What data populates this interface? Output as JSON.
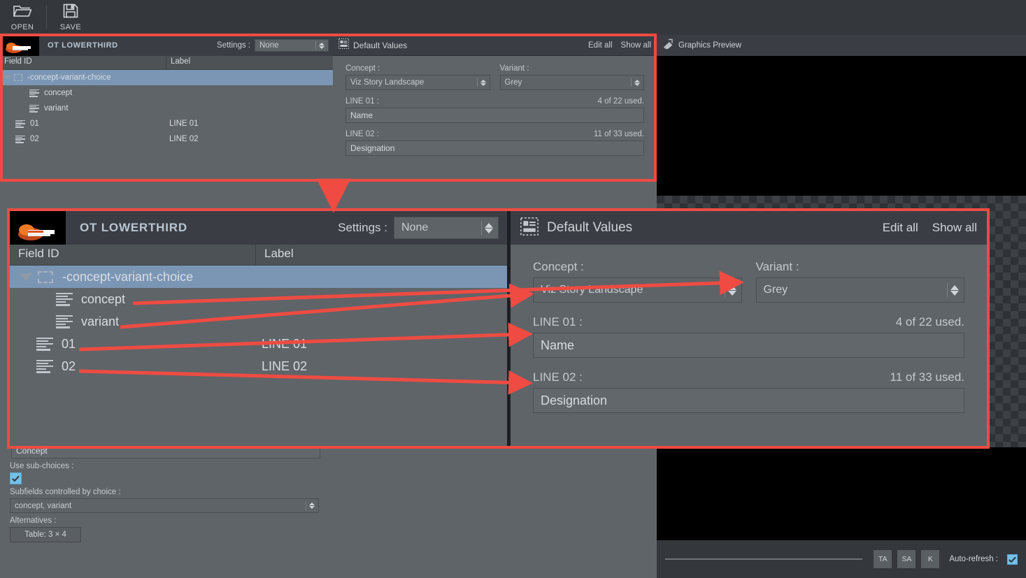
{
  "toolbar": {
    "buttons": [
      {
        "label": "OPEN",
        "icon": "folder-open-icon"
      },
      {
        "label": "SAVE",
        "icon": "floppy-disk-icon"
      }
    ]
  },
  "template_panel": {
    "title": "OT LOWERTHIRD",
    "settings_label": "Settings :",
    "settings_value": "None",
    "columns": {
      "field_id": "Field ID",
      "label": "Label"
    },
    "rows": [
      {
        "id": "-concept-variant-choice",
        "label": "",
        "icon": "dashed-box-icon",
        "indent": 0,
        "selected": true,
        "expanded": true
      },
      {
        "id": "concept",
        "label": "",
        "icon": "text-lines-icon",
        "indent": 2,
        "selected": false
      },
      {
        "id": "variant",
        "label": "",
        "icon": "text-lines-icon",
        "indent": 2,
        "selected": false
      },
      {
        "id": "01",
        "label": "LINE 01",
        "icon": "text-lines-icon",
        "indent": 1,
        "selected": false
      },
      {
        "id": "02",
        "label": "LINE 02",
        "icon": "text-lines-icon",
        "indent": 1,
        "selected": false
      }
    ]
  },
  "default_values_panel": {
    "title": "Default Values",
    "icon": "default-values-icon",
    "edit_all": "Edit all",
    "show_all": "Show all",
    "concept_label": "Concept :",
    "concept_value": "Viz Story Landscape",
    "variant_label": "Variant :",
    "variant_value": "Grey",
    "line01_label": "LINE 01 :",
    "line01_used": "4 of 22 used.",
    "line01_value": "Name",
    "line02_label": "LINE 02 :",
    "line02_used": "11 of 33 used.",
    "line02_value": "Designation"
  },
  "properties_panel": {
    "clipped_field_value": "Concept",
    "use_subchoices_label": "Use sub-choices :",
    "use_subchoices_checked": true,
    "subfields_label": "Subfields controlled by choice :",
    "subfields_value": "concept, variant",
    "alternatives_label": "Alternatives :",
    "alternatives_button": "Table: 3 × 4"
  },
  "graphics_preview": {
    "title": "Graphics Preview",
    "icon": "preview-icon",
    "buttons": [
      "TA",
      "SA",
      "K"
    ],
    "autorefresh_label": "Auto-refresh :",
    "autorefresh_checked": true
  },
  "annotation": {
    "accent_color": "#ef4b42",
    "arrow_count": 4
  },
  "colors": {
    "accent": "#ef4b42",
    "panel_bg": "#5f6468",
    "header_bg": "#3a3e44",
    "selection": "#7b96b5",
    "checkbox": "#74c0e8",
    "app_bg": "#2b2f33"
  }
}
